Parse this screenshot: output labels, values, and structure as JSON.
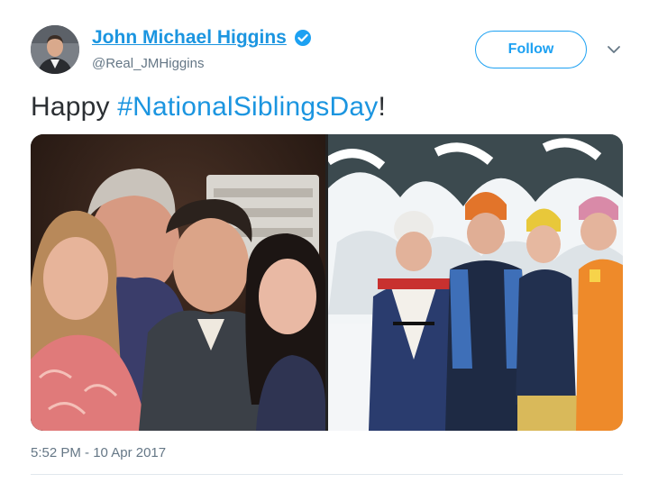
{
  "user": {
    "display_name": "John Michael Higgins",
    "handle": "@Real_JMHiggins",
    "verified": true
  },
  "follow_button": {
    "label": "Follow"
  },
  "tweet": {
    "text_before": "Happy ",
    "hashtag": "#NationalSiblingsDay",
    "text_after": "!"
  },
  "media": {
    "left_photo": "adult-siblings-group-photo",
    "right_photo": "children-in-snow-photo"
  },
  "timestamp": "5:52 PM - 10 Apr 2017",
  "colors": {
    "link_blue": "#1b95e0",
    "follow_blue": "#1da1f2",
    "secondary_text": "#657786"
  },
  "icons": [
    "verified-badge-icon",
    "chevron-down-icon"
  ]
}
